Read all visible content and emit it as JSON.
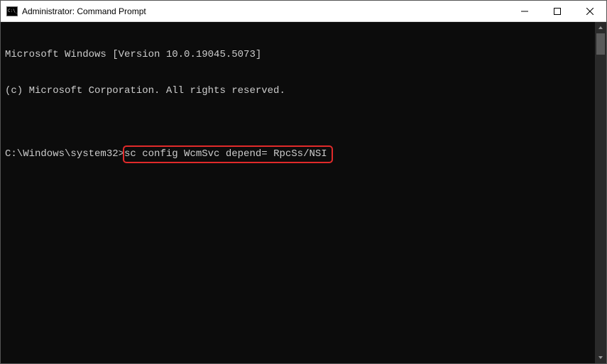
{
  "window": {
    "title": "Administrator: Command Prompt"
  },
  "terminal": {
    "line1": "Microsoft Windows [Version 10.0.19045.5073]",
    "line2": "(c) Microsoft Corporation. All rights reserved.",
    "blank": "",
    "prompt": "C:\\Windows\\system32>",
    "command": "sc config WcmSvc depend= RpcSs/NSI"
  }
}
